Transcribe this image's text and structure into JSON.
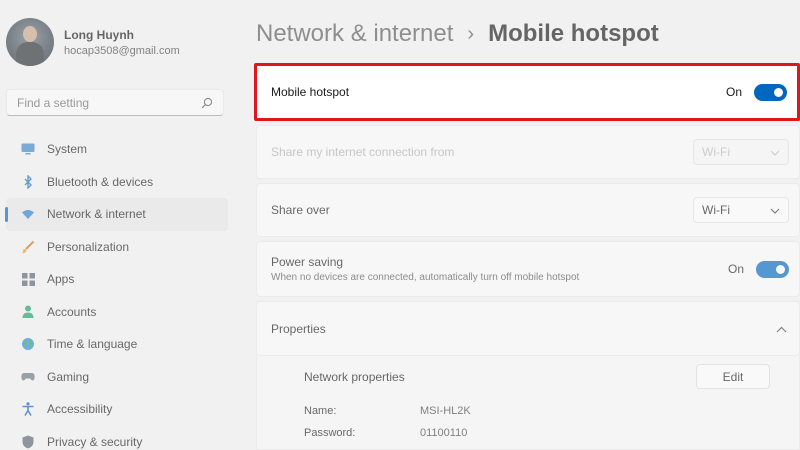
{
  "user": {
    "name": "Long Huynh",
    "email": "hocap3508@gmail.com"
  },
  "search": {
    "placeholder": "Find a setting"
  },
  "nav": [
    {
      "label": "System",
      "icon": "monitor-icon"
    },
    {
      "label": "Bluetooth & devices",
      "icon": "bluetooth-icon"
    },
    {
      "label": "Network & internet",
      "icon": "wifi-icon"
    },
    {
      "label": "Personalization",
      "icon": "brush-icon"
    },
    {
      "label": "Apps",
      "icon": "apps-icon"
    },
    {
      "label": "Accounts",
      "icon": "person-icon"
    },
    {
      "label": "Time & language",
      "icon": "globe-clock-icon"
    },
    {
      "label": "Gaming",
      "icon": "controller-icon"
    },
    {
      "label": "Accessibility",
      "icon": "accessibility-icon"
    },
    {
      "label": "Privacy & security",
      "icon": "shield-icon"
    }
  ],
  "active_nav": "Network & internet",
  "breadcrumb": {
    "parent": "Network & internet",
    "separator": "›",
    "current": "Mobile hotspot"
  },
  "hotspot": {
    "label": "Mobile hotspot",
    "state": "On"
  },
  "share_from": {
    "label": "Share my internet connection from",
    "value": "Wi-Fi"
  },
  "share_over": {
    "label": "Share over",
    "value": "Wi-Fi"
  },
  "power_saving": {
    "label": "Power saving",
    "description": "When no devices are connected, automatically turn off mobile hotspot",
    "state": "On"
  },
  "properties": {
    "label": "Properties",
    "network_title": "Network properties",
    "edit_label": "Edit",
    "name_key": "Name:",
    "name_value": "MSI-HL2K",
    "password_key": "Password:",
    "password_value": "01100110"
  },
  "colors": {
    "accent": "#0067c0",
    "highlight_border": "#e0161d"
  }
}
